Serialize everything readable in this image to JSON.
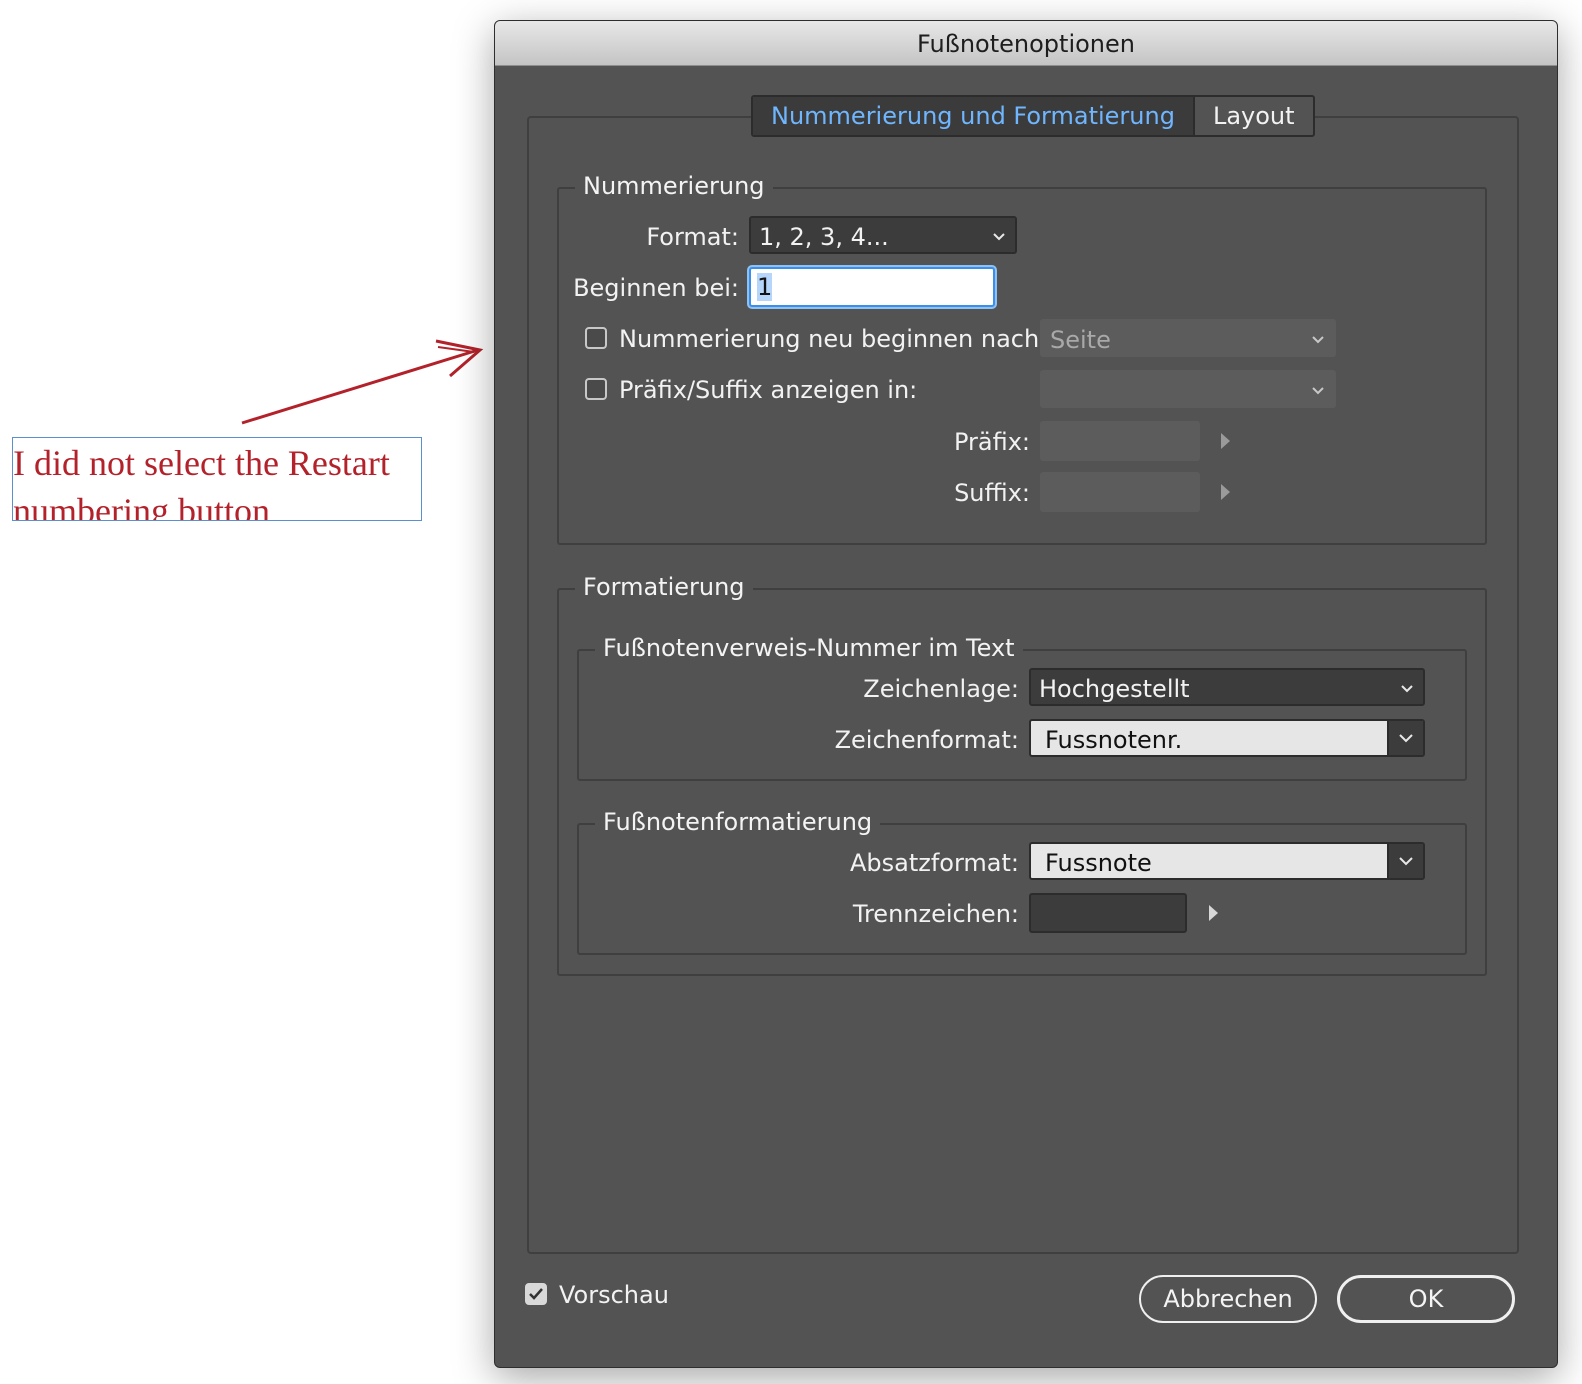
{
  "window": {
    "title": "Fußnotenoptionen"
  },
  "tabs": [
    {
      "label": "Nummerierung und Formatierung",
      "active": true
    },
    {
      "label": "Layout",
      "active": false
    }
  ],
  "numbering": {
    "legend": "Nummerierung",
    "format_label": "Format:",
    "format_value": "1, 2, 3, 4...",
    "start_label": "Beginnen bei:",
    "start_value": "1",
    "restart_label": "Nummerierung neu beginnen nach:",
    "restart_checked": false,
    "restart_value": "Seite",
    "prefix_suffix_label": "Präfix/Suffix anzeigen in:",
    "prefix_suffix_checked": false,
    "prefix_suffix_value": "",
    "prefix_label": "Präfix:",
    "prefix_value": "",
    "suffix_label": "Suffix:",
    "suffix_value": ""
  },
  "formatting": {
    "legend": "Formatierung",
    "reference": {
      "legend": "Fußnotenverweis-Nummer im Text",
      "position_label": "Zeichenlage:",
      "position_value": "Hochgestellt",
      "charstyle_label": "Zeichenformat:",
      "charstyle_value": "Fussnotenr."
    },
    "footnote": {
      "legend": "Fußnotenformatierung",
      "parastyle_label": "Absatzformat:",
      "parastyle_value": "Fussnote",
      "separator_label": "Trennzeichen:",
      "separator_value": ""
    }
  },
  "footer": {
    "preview_label": "Vorschau",
    "preview_checked": true,
    "cancel_label": "Abbrechen",
    "ok_label": "OK"
  },
  "annotation": {
    "line1": "I did not select the Restart",
    "line2": "numbering button",
    "color": "#b3222a"
  }
}
